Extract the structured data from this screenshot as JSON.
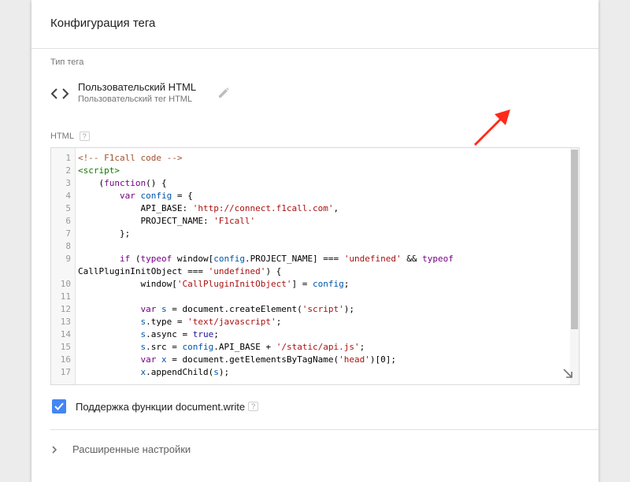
{
  "header": {
    "title": "Конфигурация тега"
  },
  "tag_type": {
    "section_label": "Тип тега",
    "icon": "code-brackets-icon",
    "name": "Пользовательский HTML",
    "subtitle": "Пользовательский тег HTML"
  },
  "html_field": {
    "label": "HTML",
    "help": "?"
  },
  "code_lines": [
    {
      "n": "1",
      "text": "<!-- F1call code -->"
    },
    {
      "n": "2",
      "text": "<script>"
    },
    {
      "n": "3",
      "text": "    (function() {"
    },
    {
      "n": "4",
      "text": "        var config = {"
    },
    {
      "n": "5",
      "text": "            API_BASE: 'http://connect.f1call.com',"
    },
    {
      "n": "6",
      "text": "            PROJECT_NAME: 'F1call'"
    },
    {
      "n": "7",
      "text": "        };"
    },
    {
      "n": "8",
      "text": ""
    },
    {
      "n": "9",
      "text": "        if (typeof window[config.PROJECT_NAME] === 'undefined' && typeof"
    },
    {
      "n": "",
      "text": "CallPluginInitObject === 'undefined') {"
    },
    {
      "n": "10",
      "text": "            window['CallPluginInitObject'] = config;"
    },
    {
      "n": "11",
      "text": ""
    },
    {
      "n": "12",
      "text": "            var s = document.createElement('script');"
    },
    {
      "n": "13",
      "text": "            s.type = 'text/javascript';"
    },
    {
      "n": "14",
      "text": "            s.async = true;"
    },
    {
      "n": "15",
      "text": "            s.src = config.API_BASE + '/static/api.js';"
    },
    {
      "n": "16",
      "text": "            var x = document.getElementsByTagName('head')[0];"
    },
    {
      "n": "17",
      "text": "            x.appendChild(s);"
    }
  ],
  "document_write": {
    "checked": true,
    "label": "Поддержка функции document.write",
    "help": "?"
  },
  "advanced": {
    "label": "Расширенные настройки"
  },
  "colors": {
    "accent": "#4285f4",
    "annotation_arrow": "#ff2a1a"
  }
}
